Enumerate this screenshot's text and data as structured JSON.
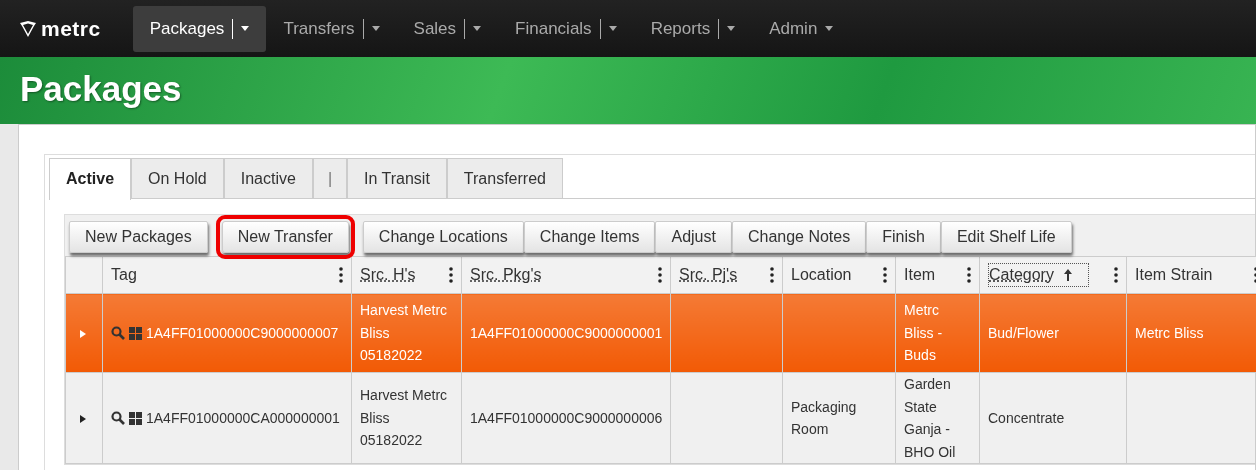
{
  "nav": {
    "logo": "metrc",
    "items": [
      {
        "label": "Packages",
        "selected": true
      },
      {
        "label": "Transfers",
        "selected": false
      },
      {
        "label": "Sales",
        "selected": false
      },
      {
        "label": "Financials",
        "selected": false
      },
      {
        "label": "Reports",
        "selected": false
      },
      {
        "label": "Admin",
        "selected": false,
        "kind": "plain"
      }
    ]
  },
  "page_title": "Packages",
  "tabs": [
    {
      "label": "Active",
      "selected": true
    },
    {
      "label": "On Hold",
      "selected": false
    },
    {
      "label": "Inactive",
      "selected": false
    },
    {
      "label": "|",
      "selected": false,
      "kind": "separator"
    },
    {
      "label": "In Transit",
      "selected": false
    },
    {
      "label": "Transferred",
      "selected": false
    }
  ],
  "toolbar": [
    {
      "label": "New Packages",
      "highlighted": false,
      "gap_after": true
    },
    {
      "label": "New Transfer",
      "highlighted": true,
      "gap_after": true
    },
    {
      "label": "Change Locations",
      "highlighted": false,
      "gap_after": false
    },
    {
      "label": "Change Items",
      "highlighted": false,
      "gap_after": false
    },
    {
      "label": "Adjust",
      "highlighted": false,
      "gap_after": false
    },
    {
      "label": "Change Notes",
      "highlighted": false,
      "gap_after": false
    },
    {
      "label": "Finish",
      "highlighted": false,
      "gap_after": false
    },
    {
      "label": "Edit Shelf Life",
      "highlighted": false,
      "gap_after": false
    }
  ],
  "table": {
    "columns": [
      {
        "label": "Tag",
        "underlined": false
      },
      {
        "label": "Src. H's",
        "underlined": true
      },
      {
        "label": "Src. Pkg's",
        "underlined": true
      },
      {
        "label": "Src. Pj's",
        "underlined": true
      },
      {
        "label": "Location",
        "underlined": false
      },
      {
        "label": "Item",
        "underlined": false
      },
      {
        "label": "Category",
        "underlined": true,
        "sort_ascending": true
      },
      {
        "label": "Item Strain",
        "underlined": false
      }
    ],
    "rows": [
      {
        "selected": true,
        "tag": "1A4FF01000000C9000000007",
        "src_harvests": "Harvest Metrc Bliss 05182022",
        "src_packages": "1A4FF01000000C9000000001",
        "item": "Metrc Bliss - Buds",
        "category": "Bud/Flower",
        "item_strain": "Metrc Bliss"
      },
      {
        "selected": false,
        "tag": "1A4FF01000000CA000000001",
        "src_harvests": "Harvest Metrc Bliss 05182022",
        "src_packages": "1A4FF01000000C9000000006",
        "location": "Packaging Room",
        "item": "Garden State Ganja - BHO Oil",
        "category": "Concentrate"
      }
    ]
  }
}
